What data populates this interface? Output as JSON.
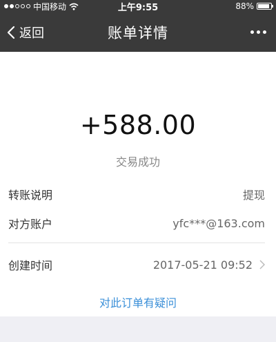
{
  "status_bar": {
    "carrier": "中国移动",
    "time": "上午9:55",
    "battery": "88%",
    "battery_level": 0.88
  },
  "nav": {
    "back_label": "返回",
    "title": "账单详情"
  },
  "detail": {
    "amount": "+588.00",
    "status": "交易成功",
    "rows": [
      {
        "label": "转账说明",
        "value": "提现"
      },
      {
        "label": "对方账户",
        "value": "yfc***@163.com"
      },
      {
        "label": "创建时间",
        "value": "2017-05-21 09:52"
      }
    ],
    "question_link": "对此订单有疑问"
  },
  "colors": {
    "nav_bg": "#3a3a3a",
    "link": "#3a8fd8",
    "page_bg": "#efeff4"
  }
}
